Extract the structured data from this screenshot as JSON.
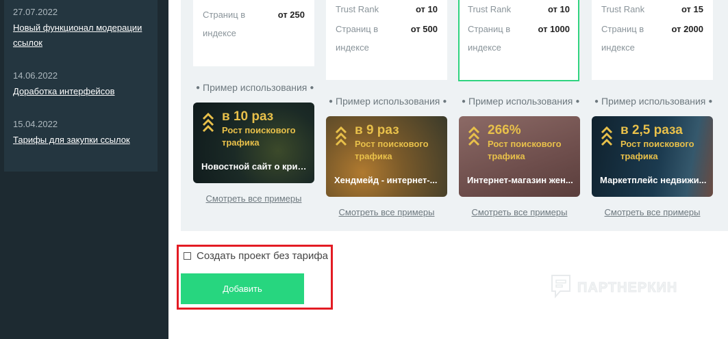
{
  "news": [
    {
      "date": "27.07.2022",
      "title": "Новый функционал модерации ссылок"
    },
    {
      "date": "14.06.2022",
      "title": "Доработка интерфейсов"
    },
    {
      "date": "15.04.2022",
      "title": "Тарифы для закупки ссылок"
    }
  ],
  "tariffs": [
    {
      "rows": [
        {
          "label": "Страниц в индексе",
          "value": "от 250"
        }
      ]
    },
    {
      "rows": [
        {
          "label": "Trust Rank",
          "value": "от 10"
        },
        {
          "label": "Страниц в индексе",
          "value": "от 500"
        }
      ]
    },
    {
      "rows": [
        {
          "label": "Trust Rank",
          "value": "от 10"
        },
        {
          "label": "Страниц в индексе",
          "value": "от 1000"
        }
      ]
    },
    {
      "rows": [
        {
          "label": "Trust Rank",
          "value": "от 15"
        },
        {
          "label": "Страниц в индексе",
          "value": "от 2000"
        }
      ]
    }
  ],
  "example_title": "Пример использования",
  "examples": [
    {
      "value": "в 10 раз",
      "sub": "Рост поискового трафика",
      "name": "Новостной сайт о крип..."
    },
    {
      "value": "в 9 раз",
      "sub": "Рост поискового трафика",
      "name": "Хендмейд - интернет-..."
    },
    {
      "value": "266%",
      "sub": "Рост поискового трафика",
      "name": "Интернет-магазин жен..."
    },
    {
      "value": "в 2,5 раза",
      "sub": "Рост поискового трафика",
      "name": "Маркетплейс недвижи..."
    }
  ],
  "see_all_label": "Смотреть все примеры",
  "form": {
    "no_tariff_label": "Создать проект без тарифа",
    "add_button": "Добавить"
  },
  "watermark": "ПАРТНЕРКИН",
  "colors": {
    "accent": "#27d67f",
    "highlight": "#e31b23",
    "gold": "#e8c04a",
    "sidebar": "#1d2a31"
  }
}
